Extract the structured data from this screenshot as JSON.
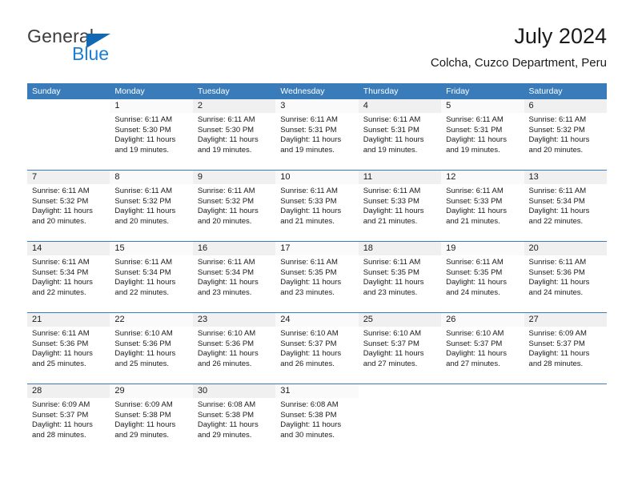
{
  "brand": {
    "word1": "General",
    "word2": "Blue",
    "triangle_icon": "brand-triangle-icon",
    "accent_color": "#1a7fd4"
  },
  "header": {
    "title": "July 2024",
    "subtitle": "Colcha, Cuzco Department, Peru"
  },
  "calendar": {
    "header_bg": "#3a7cba",
    "weekdays": [
      "Sunday",
      "Monday",
      "Tuesday",
      "Wednesday",
      "Thursday",
      "Friday",
      "Saturday"
    ],
    "weeks": [
      [
        {
          "day": "",
          "sunrise": "",
          "sunset": "",
          "daylight1": "",
          "daylight2": "",
          "empty": true
        },
        {
          "day": "1",
          "sunrise": "Sunrise: 6:11 AM",
          "sunset": "Sunset: 5:30 PM",
          "daylight1": "Daylight: 11 hours",
          "daylight2": "and 19 minutes."
        },
        {
          "day": "2",
          "sunrise": "Sunrise: 6:11 AM",
          "sunset": "Sunset: 5:30 PM",
          "daylight1": "Daylight: 11 hours",
          "daylight2": "and 19 minutes."
        },
        {
          "day": "3",
          "sunrise": "Sunrise: 6:11 AM",
          "sunset": "Sunset: 5:31 PM",
          "daylight1": "Daylight: 11 hours",
          "daylight2": "and 19 minutes."
        },
        {
          "day": "4",
          "sunrise": "Sunrise: 6:11 AM",
          "sunset": "Sunset: 5:31 PM",
          "daylight1": "Daylight: 11 hours",
          "daylight2": "and 19 minutes."
        },
        {
          "day": "5",
          "sunrise": "Sunrise: 6:11 AM",
          "sunset": "Sunset: 5:31 PM",
          "daylight1": "Daylight: 11 hours",
          "daylight2": "and 19 minutes."
        },
        {
          "day": "6",
          "sunrise": "Sunrise: 6:11 AM",
          "sunset": "Sunset: 5:32 PM",
          "daylight1": "Daylight: 11 hours",
          "daylight2": "and 20 minutes."
        }
      ],
      [
        {
          "day": "7",
          "sunrise": "Sunrise: 6:11 AM",
          "sunset": "Sunset: 5:32 PM",
          "daylight1": "Daylight: 11 hours",
          "daylight2": "and 20 minutes."
        },
        {
          "day": "8",
          "sunrise": "Sunrise: 6:11 AM",
          "sunset": "Sunset: 5:32 PM",
          "daylight1": "Daylight: 11 hours",
          "daylight2": "and 20 minutes."
        },
        {
          "day": "9",
          "sunrise": "Sunrise: 6:11 AM",
          "sunset": "Sunset: 5:32 PM",
          "daylight1": "Daylight: 11 hours",
          "daylight2": "and 20 minutes."
        },
        {
          "day": "10",
          "sunrise": "Sunrise: 6:11 AM",
          "sunset": "Sunset: 5:33 PM",
          "daylight1": "Daylight: 11 hours",
          "daylight2": "and 21 minutes."
        },
        {
          "day": "11",
          "sunrise": "Sunrise: 6:11 AM",
          "sunset": "Sunset: 5:33 PM",
          "daylight1": "Daylight: 11 hours",
          "daylight2": "and 21 minutes."
        },
        {
          "day": "12",
          "sunrise": "Sunrise: 6:11 AM",
          "sunset": "Sunset: 5:33 PM",
          "daylight1": "Daylight: 11 hours",
          "daylight2": "and 21 minutes."
        },
        {
          "day": "13",
          "sunrise": "Sunrise: 6:11 AM",
          "sunset": "Sunset: 5:34 PM",
          "daylight1": "Daylight: 11 hours",
          "daylight2": "and 22 minutes."
        }
      ],
      [
        {
          "day": "14",
          "sunrise": "Sunrise: 6:11 AM",
          "sunset": "Sunset: 5:34 PM",
          "daylight1": "Daylight: 11 hours",
          "daylight2": "and 22 minutes."
        },
        {
          "day": "15",
          "sunrise": "Sunrise: 6:11 AM",
          "sunset": "Sunset: 5:34 PM",
          "daylight1": "Daylight: 11 hours",
          "daylight2": "and 22 minutes."
        },
        {
          "day": "16",
          "sunrise": "Sunrise: 6:11 AM",
          "sunset": "Sunset: 5:34 PM",
          "daylight1": "Daylight: 11 hours",
          "daylight2": "and 23 minutes."
        },
        {
          "day": "17",
          "sunrise": "Sunrise: 6:11 AM",
          "sunset": "Sunset: 5:35 PM",
          "daylight1": "Daylight: 11 hours",
          "daylight2": "and 23 minutes."
        },
        {
          "day": "18",
          "sunrise": "Sunrise: 6:11 AM",
          "sunset": "Sunset: 5:35 PM",
          "daylight1": "Daylight: 11 hours",
          "daylight2": "and 23 minutes."
        },
        {
          "day": "19",
          "sunrise": "Sunrise: 6:11 AM",
          "sunset": "Sunset: 5:35 PM",
          "daylight1": "Daylight: 11 hours",
          "daylight2": "and 24 minutes."
        },
        {
          "day": "20",
          "sunrise": "Sunrise: 6:11 AM",
          "sunset": "Sunset: 5:36 PM",
          "daylight1": "Daylight: 11 hours",
          "daylight2": "and 24 minutes."
        }
      ],
      [
        {
          "day": "21",
          "sunrise": "Sunrise: 6:11 AM",
          "sunset": "Sunset: 5:36 PM",
          "daylight1": "Daylight: 11 hours",
          "daylight2": "and 25 minutes."
        },
        {
          "day": "22",
          "sunrise": "Sunrise: 6:10 AM",
          "sunset": "Sunset: 5:36 PM",
          "daylight1": "Daylight: 11 hours",
          "daylight2": "and 25 minutes."
        },
        {
          "day": "23",
          "sunrise": "Sunrise: 6:10 AM",
          "sunset": "Sunset: 5:36 PM",
          "daylight1": "Daylight: 11 hours",
          "daylight2": "and 26 minutes."
        },
        {
          "day": "24",
          "sunrise": "Sunrise: 6:10 AM",
          "sunset": "Sunset: 5:37 PM",
          "daylight1": "Daylight: 11 hours",
          "daylight2": "and 26 minutes."
        },
        {
          "day": "25",
          "sunrise": "Sunrise: 6:10 AM",
          "sunset": "Sunset: 5:37 PM",
          "daylight1": "Daylight: 11 hours",
          "daylight2": "and 27 minutes."
        },
        {
          "day": "26",
          "sunrise": "Sunrise: 6:10 AM",
          "sunset": "Sunset: 5:37 PM",
          "daylight1": "Daylight: 11 hours",
          "daylight2": "and 27 minutes."
        },
        {
          "day": "27",
          "sunrise": "Sunrise: 6:09 AM",
          "sunset": "Sunset: 5:37 PM",
          "daylight1": "Daylight: 11 hours",
          "daylight2": "and 28 minutes."
        }
      ],
      [
        {
          "day": "28",
          "sunrise": "Sunrise: 6:09 AM",
          "sunset": "Sunset: 5:37 PM",
          "daylight1": "Daylight: 11 hours",
          "daylight2": "and 28 minutes."
        },
        {
          "day": "29",
          "sunrise": "Sunrise: 6:09 AM",
          "sunset": "Sunset: 5:38 PM",
          "daylight1": "Daylight: 11 hours",
          "daylight2": "and 29 minutes."
        },
        {
          "day": "30",
          "sunrise": "Sunrise: 6:08 AM",
          "sunset": "Sunset: 5:38 PM",
          "daylight1": "Daylight: 11 hours",
          "daylight2": "and 29 minutes."
        },
        {
          "day": "31",
          "sunrise": "Sunrise: 6:08 AM",
          "sunset": "Sunset: 5:38 PM",
          "daylight1": "Daylight: 11 hours",
          "daylight2": "and 30 minutes."
        },
        {
          "day": "",
          "sunrise": "",
          "sunset": "",
          "daylight1": "",
          "daylight2": "",
          "empty": true
        },
        {
          "day": "",
          "sunrise": "",
          "sunset": "",
          "daylight1": "",
          "daylight2": "",
          "empty": true
        },
        {
          "day": "",
          "sunrise": "",
          "sunset": "",
          "daylight1": "",
          "daylight2": "",
          "empty": true
        }
      ]
    ]
  }
}
